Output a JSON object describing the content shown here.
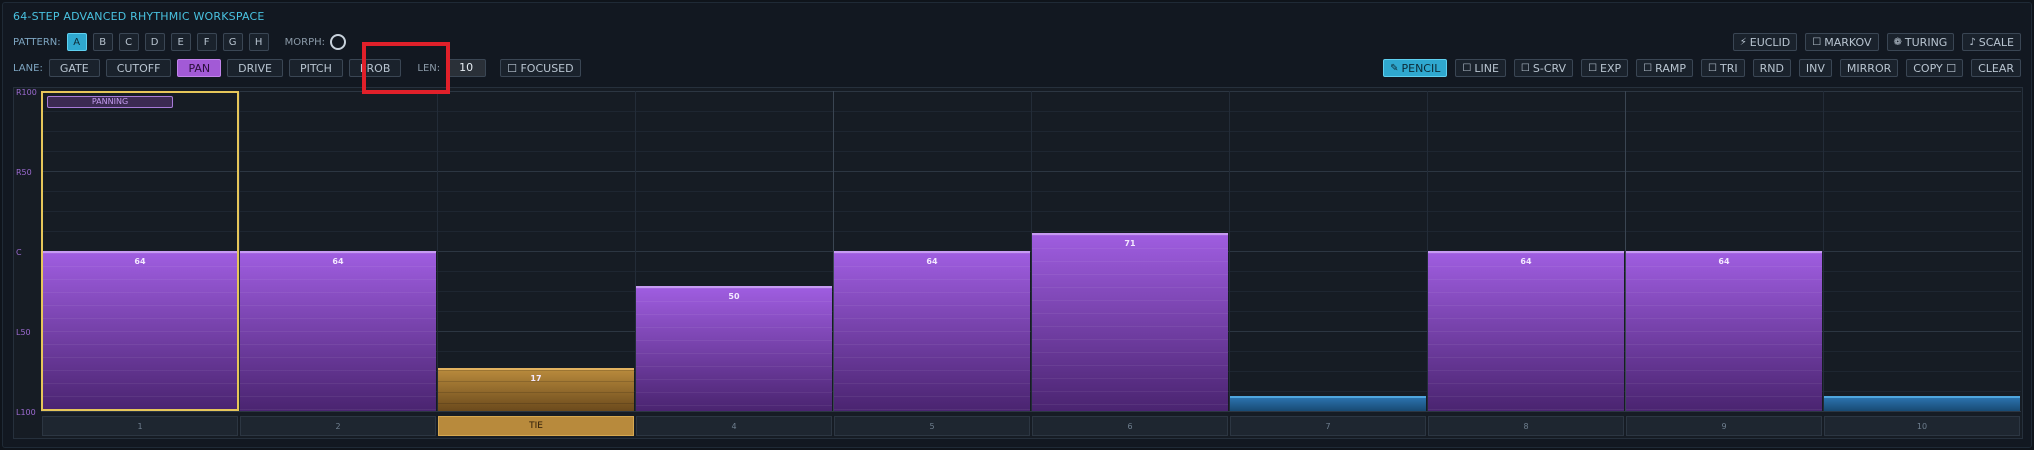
{
  "app_title": "64-STEP ADVANCED RHYTHMIC WORKSPACE",
  "pattern": {
    "label": "PATTERN:",
    "buttons": [
      "A",
      "B",
      "C",
      "D",
      "E",
      "F",
      "G",
      "H"
    ],
    "active": "A",
    "morph_label": "MORPH:"
  },
  "lane": {
    "label": "LANE:",
    "buttons": [
      "GATE",
      "CUTOFF",
      "PAN",
      "DRIVE",
      "PITCH",
      "PROB"
    ],
    "active": "PAN",
    "len_label": "LEN:",
    "len_value": "10",
    "focused_label": "☐ FOCUSED"
  },
  "generators": [
    {
      "icon": "⚡",
      "label": "EUCLID"
    },
    {
      "icon": "☐",
      "label": "MARKOV"
    },
    {
      "icon": "❁",
      "label": "TURING"
    },
    {
      "icon": "♪",
      "label": "SCALE"
    }
  ],
  "tools": [
    {
      "icon": "✎",
      "label": "PENCIL",
      "active": true
    },
    {
      "icon": "☐",
      "label": "LINE"
    },
    {
      "icon": "☐",
      "label": "S-CRV"
    },
    {
      "icon": "☐",
      "label": "EXP"
    },
    {
      "icon": "☐",
      "label": "RAMP"
    },
    {
      "icon": "☐",
      "label": "TRI"
    },
    {
      "icon": "",
      "label": "RND"
    },
    {
      "icon": "",
      "label": "INV"
    },
    {
      "icon": "",
      "label": "MIRROR"
    },
    {
      "icon": "",
      "label": "COPY ☐"
    },
    {
      "icon": "",
      "label": "CLEAR"
    }
  ],
  "y_axis": [
    "R100",
    "R50",
    "C",
    "L50",
    "L100"
  ],
  "lane_tag": "PANNING",
  "steps": [
    {
      "label": "1",
      "value": 64,
      "shown": "64",
      "selected": true
    },
    {
      "label": "2",
      "value": 64,
      "shown": "64"
    },
    {
      "label": "TIE",
      "value": 17,
      "shown": "17",
      "tie": true
    },
    {
      "label": "4",
      "value": 50,
      "shown": "50"
    },
    {
      "label": "5",
      "value": 64,
      "shown": "64"
    },
    {
      "label": "6",
      "value": 71,
      "shown": "71"
    },
    {
      "label": "7",
      "value": 6,
      "shown": "",
      "low": true
    },
    {
      "label": "8",
      "value": 64,
      "shown": "64"
    },
    {
      "label": "9",
      "value": 64,
      "shown": "64"
    },
    {
      "label": "10",
      "value": 6,
      "shown": "",
      "low": true
    }
  ],
  "colors": {
    "accent_cyan": "#2fa8cf",
    "accent_purple": "#a25ad6",
    "tie_gold": "#b88a3c",
    "highlight_red": "#e0202a"
  }
}
